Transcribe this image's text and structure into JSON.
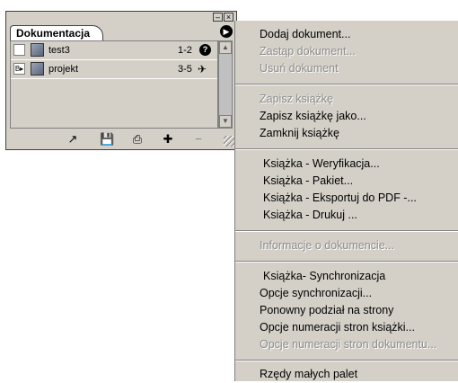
{
  "palette": {
    "tab_label": "Dokumentacja",
    "window_buttons": [
      "–",
      "×"
    ],
    "menu_arrow": "▶",
    "documents": [
      {
        "name": "test3",
        "pages": "1-2",
        "status_icon": "missing-icon",
        "status_glyph": "?"
      },
      {
        "name": "projekt",
        "pages": "3-5",
        "status_icon": "book-source-icon",
        "status_glyph": "✈"
      }
    ],
    "toolbar_icons": [
      "synchronize-icon",
      "save-book-icon",
      "print-book-icon",
      "add-document-icon",
      "remove-document-icon"
    ],
    "toolbar_glyphs": [
      "↗",
      "💾",
      "⎙",
      "✚",
      "−"
    ]
  },
  "menu": {
    "items": [
      {
        "label": "Dodaj dokument...",
        "enabled": true
      },
      {
        "label": "Zastąp dokument...",
        "enabled": false
      },
      {
        "label": "Usuń dokument",
        "enabled": false
      },
      {
        "separator": true
      },
      {
        "label": "Zapisz książkę",
        "enabled": false
      },
      {
        "label": "Zapisz książkę jako...",
        "enabled": true
      },
      {
        "label": "Zamknij książkę",
        "enabled": true
      },
      {
        "separator": true
      },
      {
        "label": "Książka - Weryfikacja...",
        "enabled": true
      },
      {
        "label": "Książka - Pakiet...",
        "enabled": true
      },
      {
        "label": "Książka - Eksportuj do PDF -...",
        "enabled": true
      },
      {
        "label": "Książka - Drukuj ...",
        "enabled": true
      },
      {
        "separator": true
      },
      {
        "label": "Informacje o dokumencie...",
        "enabled": false
      },
      {
        "separator": true
      },
      {
        "label": "Książka- Synchronizacja",
        "enabled": true
      },
      {
        "label": "Opcje synchronizacji...",
        "enabled": true
      },
      {
        "label": "Ponowny podział na strony",
        "enabled": true
      },
      {
        "label": "Opcje numeracji stron książki...",
        "enabled": true
      },
      {
        "label": "Opcje numeracji stron dokumentu...",
        "enabled": false
      },
      {
        "separator": true
      },
      {
        "label": "Rzędy małych palet",
        "enabled": true
      }
    ]
  }
}
